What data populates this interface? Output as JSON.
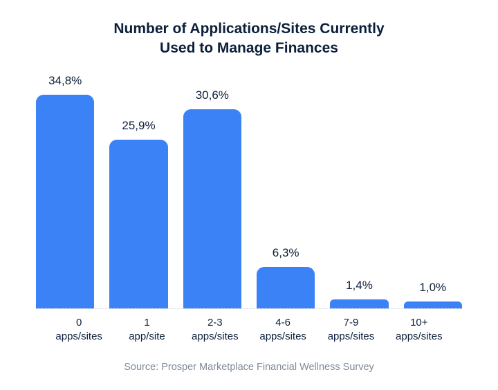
{
  "title_line1": "Number of Applications/Sites Currently",
  "title_line2": "Used to Manage Finances",
  "source": "Source: Prosper Marketplace Financial Wellness Survey",
  "bar_color": "#3b82f6",
  "chart_data": {
    "type": "bar",
    "title": "Number of Applications/Sites Currently Used to Manage Finances",
    "xlabel": "",
    "ylabel": "",
    "ylim": [
      0,
      36
    ],
    "categories": [
      "0 apps/sites",
      "1 app/site",
      "2-3 apps/sites",
      "4-6 apps/sites",
      "7-9 apps/sites",
      "10+ apps/sites"
    ],
    "category_lines": [
      [
        "0",
        "apps/sites"
      ],
      [
        "1",
        "app/site"
      ],
      [
        "2-3",
        "apps/sites"
      ],
      [
        "4-6",
        "apps/sites"
      ],
      [
        "7-9",
        "apps/sites"
      ],
      [
        "10+",
        "apps/sites"
      ]
    ],
    "values": [
      34.8,
      25.9,
      30.6,
      6.3,
      1.4,
      1.0
    ],
    "value_labels": [
      "34,8%",
      "25,9%",
      "30,6%",
      "6,3%",
      "1,4%",
      "1,0%"
    ]
  }
}
